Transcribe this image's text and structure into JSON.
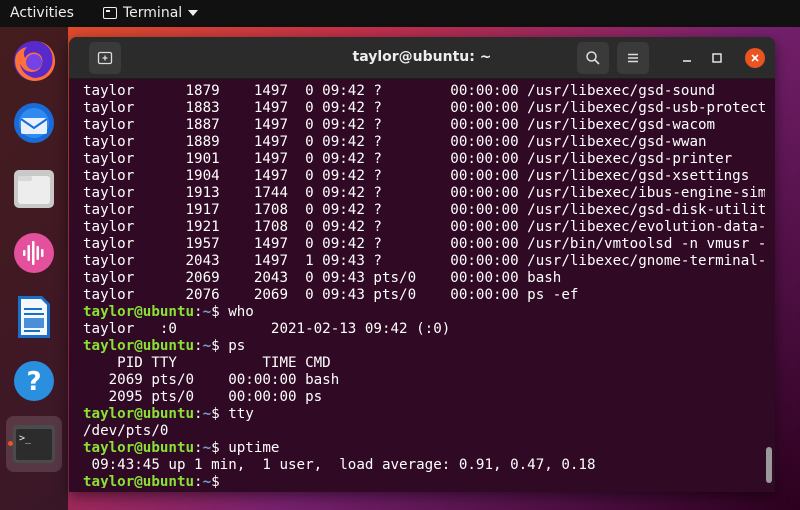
{
  "topbar": {
    "activities": "Activities",
    "app_name": "Terminal"
  },
  "dock": {
    "items": [
      {
        "name": "firefox"
      },
      {
        "name": "thunderbird"
      },
      {
        "name": "files"
      },
      {
        "name": "rhythmbox"
      },
      {
        "name": "libreoffice-writer"
      },
      {
        "name": "help"
      },
      {
        "name": "terminal",
        "label": ">_"
      }
    ]
  },
  "window": {
    "title": "taylor@ubuntu: ~"
  },
  "prompt": {
    "user_host": "taylor@ubuntu",
    "colon": ":",
    "path": "~",
    "dollar": "$"
  },
  "terminal": {
    "lines": [
      {
        "type": "out",
        "text": "taylor      1879    1497  0 09:42 ?        00:00:00 /usr/libexec/gsd-sound"
      },
      {
        "type": "out",
        "text": "taylor      1883    1497  0 09:42 ?        00:00:00 /usr/libexec/gsd-usb-protect"
      },
      {
        "type": "out",
        "text": "taylor      1887    1497  0 09:42 ?        00:00:00 /usr/libexec/gsd-wacom"
      },
      {
        "type": "out",
        "text": "taylor      1889    1497  0 09:42 ?        00:00:00 /usr/libexec/gsd-wwan"
      },
      {
        "type": "out",
        "text": "taylor      1901    1497  0 09:42 ?        00:00:00 /usr/libexec/gsd-printer"
      },
      {
        "type": "out",
        "text": "taylor      1904    1497  0 09:42 ?        00:00:00 /usr/libexec/gsd-xsettings"
      },
      {
        "type": "out",
        "text": "taylor      1913    1744  0 09:42 ?        00:00:00 /usr/libexec/ibus-engine-sim"
      },
      {
        "type": "out",
        "text": "taylor      1917    1708  0 09:42 ?        00:00:00 /usr/libexec/gsd-disk-utilit"
      },
      {
        "type": "out",
        "text": "taylor      1921    1708  0 09:42 ?        00:00:00 /usr/libexec/evolution-data-"
      },
      {
        "type": "out",
        "text": "taylor      1957    1497  0 09:42 ?        00:00:00 /usr/bin/vmtoolsd -n vmusr -"
      },
      {
        "type": "out",
        "text": "taylor      2043    1497  1 09:43 ?        00:00:00 /usr/libexec/gnome-terminal-"
      },
      {
        "type": "out",
        "text": "taylor      2069    2043  0 09:43 pts/0    00:00:00 bash"
      },
      {
        "type": "out",
        "text": "taylor      2076    2069  0 09:43 pts/0    00:00:00 ps -ef"
      },
      {
        "type": "cmd",
        "text": " who"
      },
      {
        "type": "out",
        "text": "taylor   :0           2021-02-13 09:42 (:0)"
      },
      {
        "type": "cmd",
        "text": " ps"
      },
      {
        "type": "out",
        "text": "    PID TTY          TIME CMD"
      },
      {
        "type": "out",
        "text": "   2069 pts/0    00:00:00 bash"
      },
      {
        "type": "out",
        "text": "   2095 pts/0    00:00:00 ps"
      },
      {
        "type": "cmd",
        "text": " tty"
      },
      {
        "type": "out",
        "text": "/dev/pts/0"
      },
      {
        "type": "cmd",
        "text": " uptime"
      },
      {
        "type": "out",
        "text": " 09:43:45 up 1 min,  1 user,  load average: 0.91, 0.47, 0.18"
      },
      {
        "type": "cmd",
        "text": " "
      }
    ]
  },
  "colors": {
    "terminal_bg": "#300a24",
    "prompt_user": "#8ae234",
    "prompt_path": "#729fcf",
    "close_button": "#e95420"
  }
}
